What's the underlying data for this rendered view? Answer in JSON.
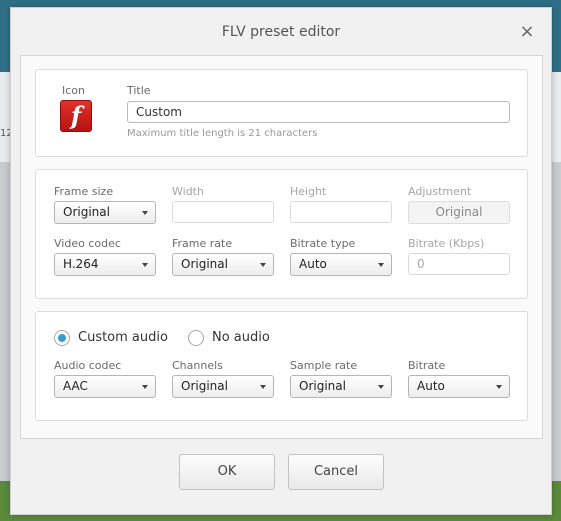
{
  "background": {
    "partial_number": "12"
  },
  "dialog": {
    "title": "FLV preset editor",
    "close_symbol": "×",
    "general": {
      "icon_label": "Icon",
      "icon_name": "flash-icon",
      "icon_glyph": "f",
      "title_label": "Title",
      "title_value": "Custom",
      "title_hint": "Maximum title length is 21 characters"
    },
    "video": {
      "frame_size_label": "Frame size",
      "frame_size_value": "Original",
      "width_label": "Width",
      "width_value": "",
      "height_label": "Height",
      "height_value": "",
      "adjustment_label": "Adjustment",
      "adjustment_value": "Original",
      "video_codec_label": "Video codec",
      "video_codec_value": "H.264",
      "frame_rate_label": "Frame rate",
      "frame_rate_value": "Original",
      "bitrate_type_label": "Bitrate type",
      "bitrate_type_value": "Auto",
      "bitrate_label": "Bitrate (Kbps)",
      "bitrate_value": "0"
    },
    "audio": {
      "custom_audio_label": "Custom audio",
      "custom_audio_selected": true,
      "no_audio_label": "No audio",
      "audio_codec_label": "Audio codec",
      "audio_codec_value": "AAC",
      "channels_label": "Channels",
      "channels_value": "Original",
      "sample_rate_label": "Sample rate",
      "sample_rate_value": "Original",
      "bitrate_label": "Bitrate",
      "bitrate_value": "Auto"
    },
    "ok_label": "OK",
    "cancel_label": "Cancel",
    "accent_color": "#3a9bd0"
  }
}
